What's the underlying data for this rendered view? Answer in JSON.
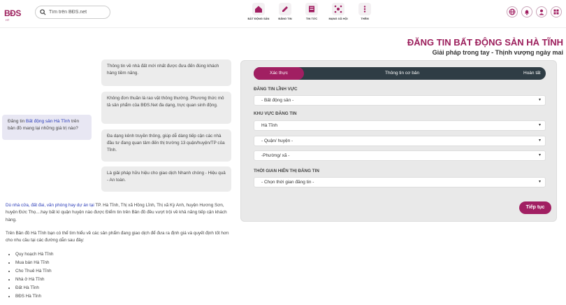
{
  "header": {
    "logo_text": "BĐS",
    "logo_sub": "HT",
    "search_placeholder": "Tìm trên BĐS.net",
    "nav": [
      {
        "label": "BẤT ĐỘNG SẢN",
        "icon": "house-icon"
      },
      {
        "label": "ĐĂNG TIN",
        "icon": "post-icon"
      },
      {
        "label": "TIN TỨC",
        "icon": "news-icon"
      },
      {
        "label": "MẠNG XÃ HỘI",
        "icon": "social-icon"
      },
      {
        "label": "THÊM",
        "icon": "more-icon"
      }
    ]
  },
  "page": {
    "title": "ĐĂNG TIN BẤT ĐỘNG SẢN HÀ TĨNH",
    "subtitle": "Giải pháp trong tay - Thịnh vượng ngày mai"
  },
  "question": {
    "prefix": "Đăng tin ",
    "highlight": "Bất động sản Hà Tĩnh",
    "suffix": " trên bản đồ mang lại những giá trị nào?"
  },
  "info_bubbles": [
    "Thông tin về nhà đất mới nhất được đưa đến đúng khách hàng tiềm năng.",
    "Không đơn thuần là rao vặt thông thường. Phương thức mô tả sản phẩm của BĐS.Net đa dạng, trực quan sinh động.",
    "Đa dạng kênh truyền thông, giúp dễ dàng tiếp cận các nhà đầu tư đang quan tâm đến thị trường 13 quận/huyện/TP của Tỉnh.",
    "Là giải pháp hữu hiệu cho giao dịch Nhanh chóng - Hiệu quả - An toàn."
  ],
  "form": {
    "steps": [
      "Xác thực",
      "Thông tin cơ bản",
      "Hoàn tất"
    ],
    "section_category": "ĐĂNG TIN LĨNH VỰC",
    "category_value": "- Bất động sản -",
    "section_area": "KHU VỰC ĐĂNG TIN",
    "province_value": "Hà Tĩnh",
    "district_value": "- Quận/ huyện -",
    "ward_value": "-Phường/ xã -",
    "section_time": "THỜI GIAN HIỂN THỊ ĐĂNG TIN",
    "time_value": "- Chọn thời gian đăng tin -",
    "next_label": "Tiếp tục"
  },
  "content": {
    "p1_link": "Dù nhà cửa, đất đai, văn phòng hay dự án tại",
    "p1_rest": " TP. Hà Tĩnh, Thị xã Hồng Lĩnh, Thị xã Kỳ Anh, huyện Hương Sơn, huyện Đức Thọ....hay bất kì quận huyện nào được Điểm tin trên Bản đồ đều vượt trội về khả năng tiếp cận khách hàng.",
    "p2": "Trên Bản đồ Hà Tĩnh bạn có thể tìm hiểu về các sản phẩm đang giao dịch để đưa ra định giá và quyết định tốt hơn cho nhu cầu tại các đường dẫn sau đây:",
    "links": [
      "Quy hoạch Hà Tĩnh",
      "Mua bán Hà Tĩnh",
      "Cho Thuê Hà Tĩnh",
      "Nhà ở Hà Tĩnh",
      "Đất Hà Tĩnh",
      "BĐS Hà Tĩnh"
    ]
  },
  "colors": {
    "brand": "#a11f62",
    "stepbar": "#2f3d45",
    "link": "#2a3bb8"
  }
}
